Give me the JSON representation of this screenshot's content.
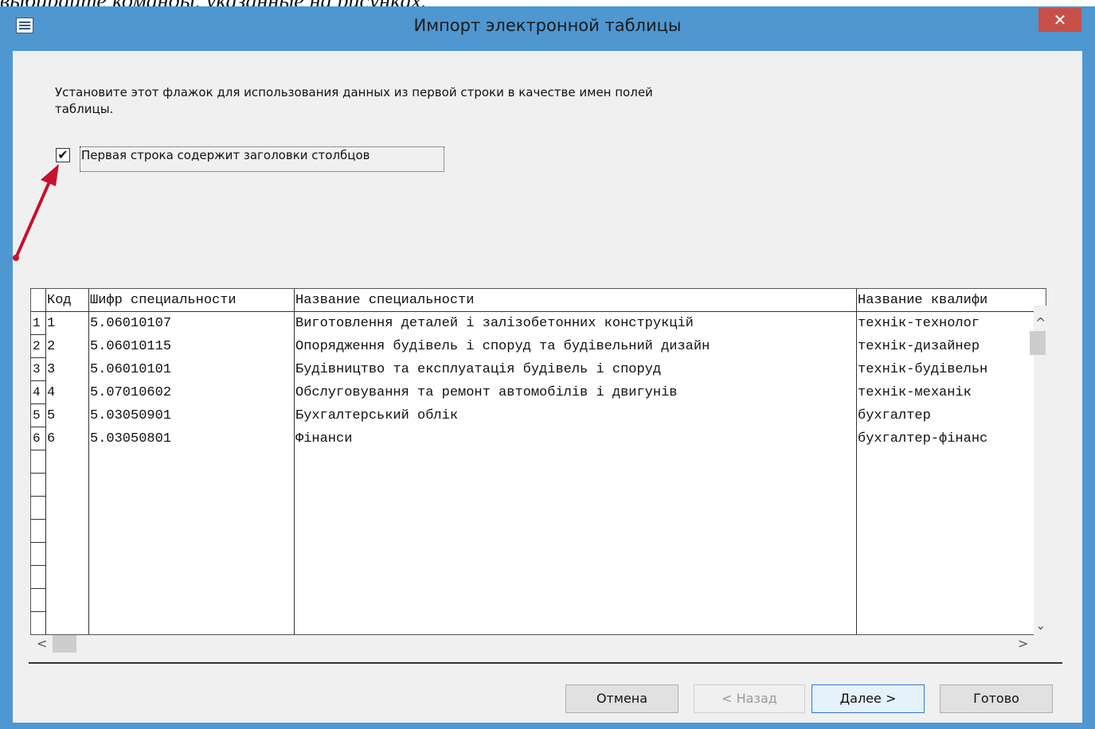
{
  "caption": "выбирайте команды, указанные на рисунках.",
  "window": {
    "title": "Импорт электронной таблицы",
    "close_glyph": "✕",
    "app_icon": "table-icon"
  },
  "instruction": "Установите этот флажок для использования данных из первой строки в качестве имен полей таблицы.",
  "checkbox": {
    "label": "Первая строка содержит заголовки столбцов",
    "checked": true,
    "glyph": "✔"
  },
  "annotation": {
    "arrow_color": "#c8102e"
  },
  "table": {
    "columns": [
      "Код",
      "Шифр специальности",
      "Название специальности",
      "Название квалифи"
    ],
    "row_numbers": [
      "1",
      "2",
      "3",
      "4",
      "5",
      "6"
    ],
    "rows": [
      [
        "1",
        "5.06010107",
        "Виготовлення деталей і залізобетонних конструкцій",
        "технік-технолог"
      ],
      [
        "2",
        "5.06010115",
        "Опорядження будівель і споруд та будівельний дизайн",
        "технік-дизайнер"
      ],
      [
        "3",
        "5.06010101",
        "Будівництво та експлуатація будівель і споруд",
        "технік-будівельн"
      ],
      [
        "4",
        "5.07010602",
        "Обслуговування та ремонт автомобілів і двигунів",
        "технік-механік"
      ],
      [
        "5",
        "5.03050901",
        "Бухгалтерський облік",
        "бухгалтер"
      ],
      [
        "6",
        "5.03050801",
        "Фінанси",
        "бухгалтер-фінанс"
      ]
    ]
  },
  "scroll": {
    "up": "^",
    "down": "⌄",
    "left": "<",
    "right": ">"
  },
  "buttons": {
    "cancel": "Отмена",
    "back": "< Назад",
    "next": "Далее >",
    "finish": "Готово"
  }
}
